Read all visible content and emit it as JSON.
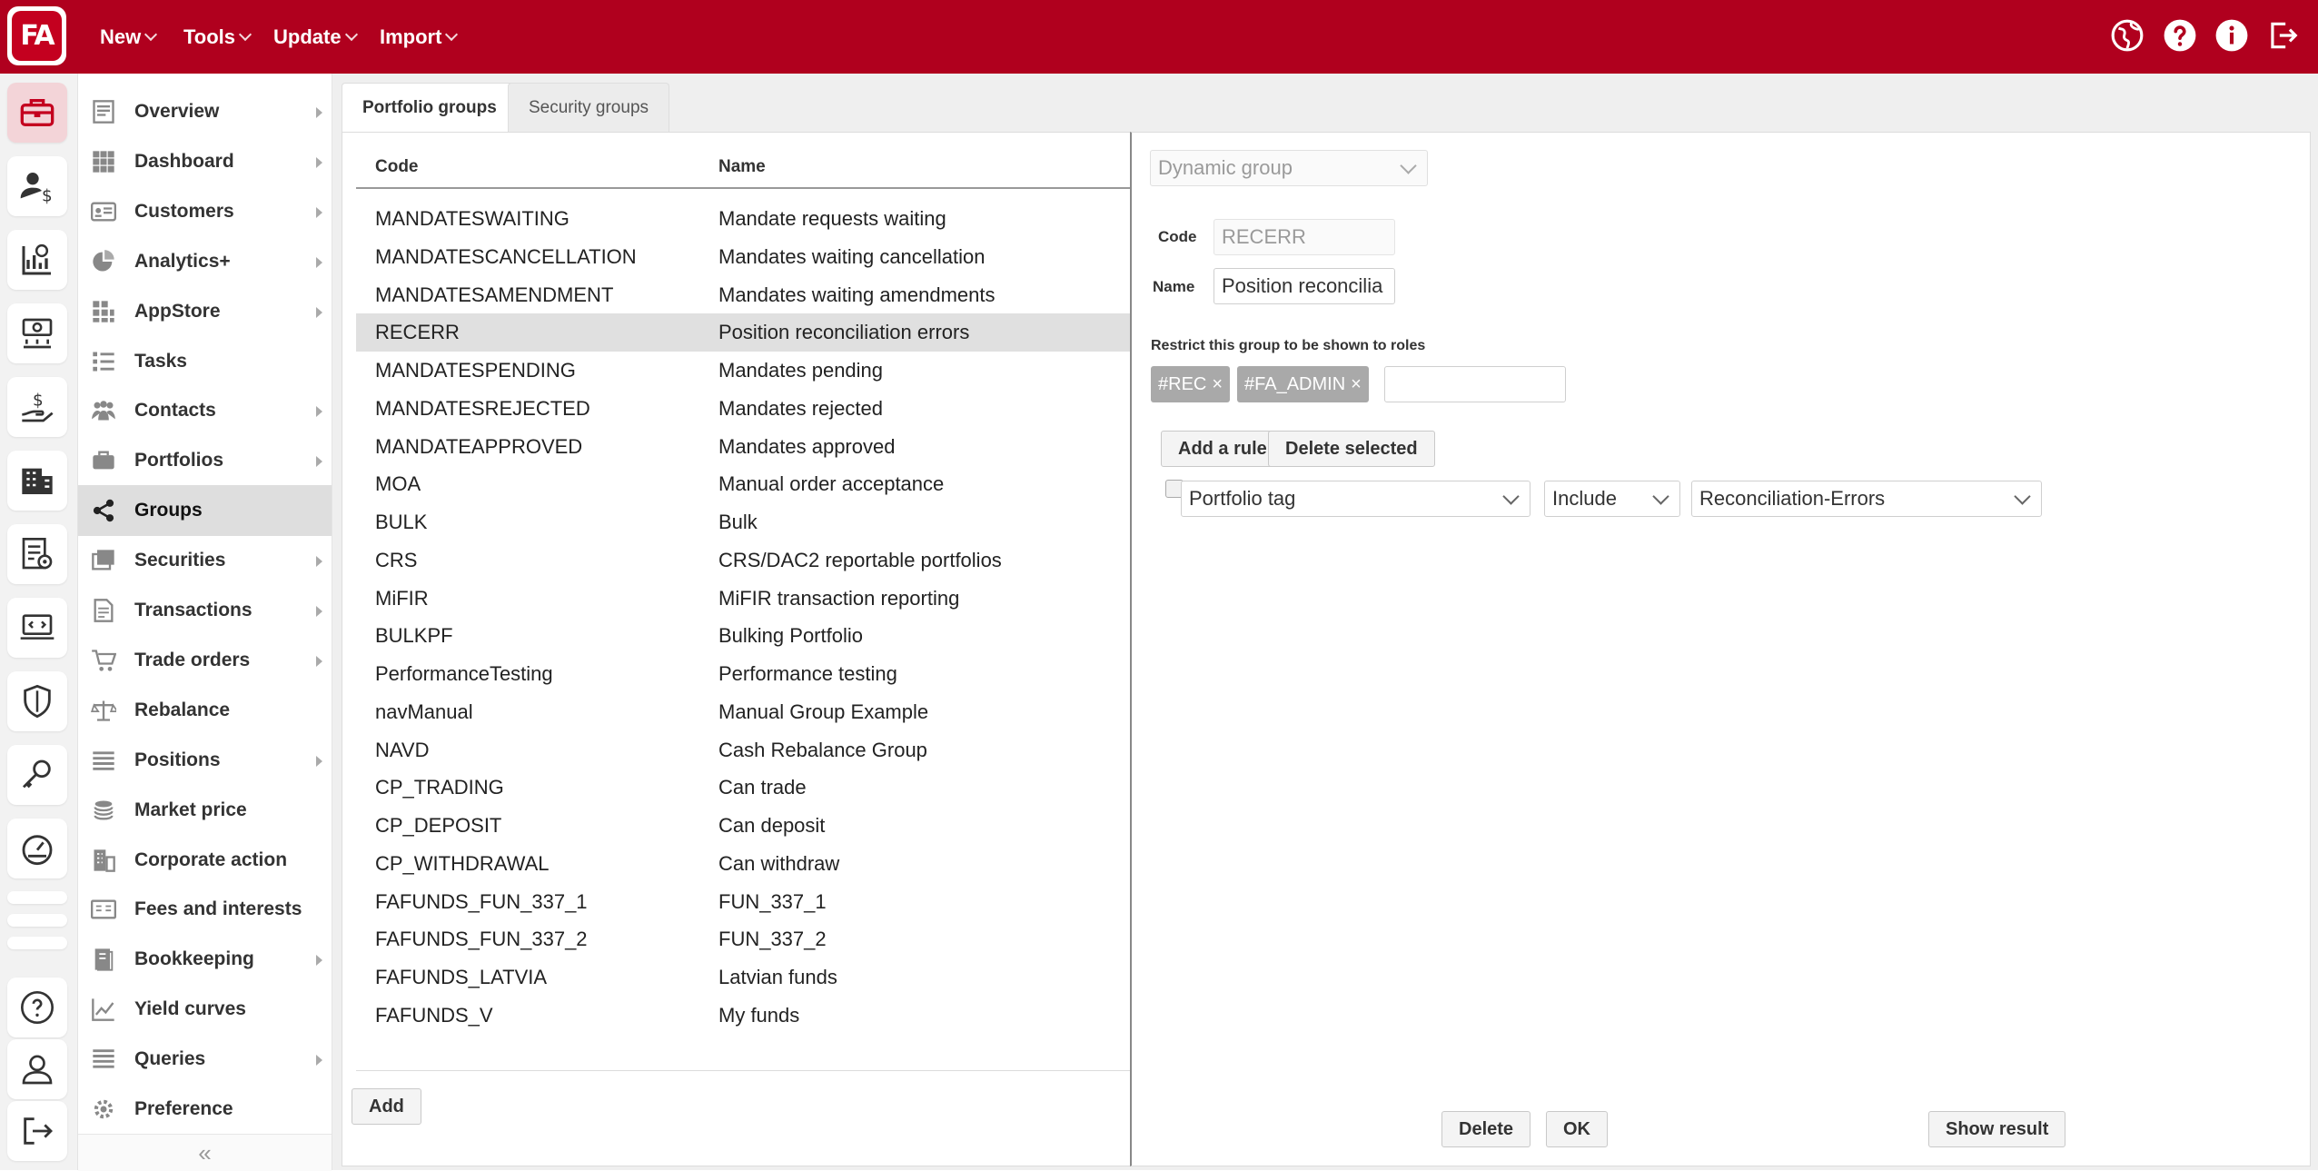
{
  "app": {
    "logo_text": "FA",
    "colors": {
      "brand": "#b0001e",
      "accent_active": "#f3d4d8"
    }
  },
  "topnav": {
    "menus": [
      {
        "label": "New"
      },
      {
        "label": "Tools"
      },
      {
        "label": "Update"
      },
      {
        "label": "Import"
      }
    ],
    "icons": [
      "globe-icon",
      "help-icon",
      "info-icon",
      "logout-icon"
    ]
  },
  "rail": {
    "icons": [
      "briefcase-icon",
      "customer-money-icon",
      "analytics-icon",
      "cash-flow-icon",
      "payment-hand-icon",
      "building-icon",
      "document-settings-icon",
      "laptop-code-icon",
      "shield-icon",
      "key-icon",
      "speedometer-icon",
      "help-circle-icon",
      "user-icon",
      "sign-out-icon"
    ]
  },
  "sidebar": {
    "items": [
      {
        "label": "Overview",
        "icon": "overview-icon",
        "has_arrow": true
      },
      {
        "label": "Dashboard",
        "icon": "dashboard-grid-icon",
        "has_arrow": true
      },
      {
        "label": "Customers",
        "icon": "id-card-icon",
        "has_arrow": true
      },
      {
        "label": "Analytics+",
        "icon": "pie-chart-icon",
        "has_arrow": true
      },
      {
        "label": "AppStore",
        "icon": "apps-icon",
        "has_arrow": true
      },
      {
        "label": "Tasks",
        "icon": "tasks-list-icon",
        "has_arrow": false
      },
      {
        "label": "Contacts",
        "icon": "contacts-icon",
        "has_arrow": true
      },
      {
        "label": "Portfolios",
        "icon": "briefcase-icon",
        "has_arrow": true
      },
      {
        "label": "Groups",
        "icon": "share-icon",
        "has_arrow": false,
        "active": true
      },
      {
        "label": "Securities",
        "icon": "securities-icon",
        "has_arrow": true
      },
      {
        "label": "Transactions",
        "icon": "document-icon",
        "has_arrow": true
      },
      {
        "label": "Trade orders",
        "icon": "cart-icon",
        "has_arrow": true
      },
      {
        "label": "Rebalance",
        "icon": "scale-icon",
        "has_arrow": false
      },
      {
        "label": "Positions",
        "icon": "lines-icon",
        "has_arrow": true
      },
      {
        "label": "Market price",
        "icon": "coins-icon",
        "has_arrow": false
      },
      {
        "label": "Corporate action",
        "icon": "office-icon",
        "has_arrow": false
      },
      {
        "label": "Fees and interests",
        "icon": "fee-icon",
        "has_arrow": false
      },
      {
        "label": "Bookkeeping",
        "icon": "book-icon",
        "has_arrow": true
      },
      {
        "label": "Yield curves",
        "icon": "line-chart-icon",
        "has_arrow": false
      },
      {
        "label": "Queries",
        "icon": "list-icon",
        "has_arrow": true
      },
      {
        "label": "Preference",
        "icon": "gear-icon",
        "has_arrow": false
      }
    ],
    "collapse_glyph": "«"
  },
  "tabs": [
    {
      "label": "Portfolio groups",
      "active": true
    },
    {
      "label": "Security groups",
      "active": false
    }
  ],
  "table": {
    "columns": [
      "Code",
      "Name"
    ],
    "rows": [
      {
        "code": "MANDATESWAITING",
        "name": "Mandate requests waiting"
      },
      {
        "code": "MANDATESCANCELLATION",
        "name": "Mandates waiting cancellation"
      },
      {
        "code": "MANDATESAMENDMENT",
        "name": "Mandates waiting amendments"
      },
      {
        "code": "RECERR",
        "name": "Position reconciliation errors",
        "selected": true
      },
      {
        "code": "MANDATESPENDING",
        "name": "Mandates pending"
      },
      {
        "code": "MANDATESREJECTED",
        "name": "Mandates rejected"
      },
      {
        "code": "MANDATEAPPROVED",
        "name": "Mandates approved"
      },
      {
        "code": "MOA",
        "name": "Manual order acceptance"
      },
      {
        "code": "BULK",
        "name": "Bulk"
      },
      {
        "code": "CRS",
        "name": "CRS/DAC2 reportable portfolios"
      },
      {
        "code": "MiFIR",
        "name": "MiFIR transaction reporting"
      },
      {
        "code": "BULKPF",
        "name": "Bulking Portfolio"
      },
      {
        "code": "PerformanceTesting",
        "name": "Performance testing"
      },
      {
        "code": "navManual",
        "name": "Manual Group Example"
      },
      {
        "code": "NAVD",
        "name": "Cash Rebalance Group"
      },
      {
        "code": "CP_TRADING",
        "name": "Can trade"
      },
      {
        "code": "CP_DEPOSIT",
        "name": "Can deposit"
      },
      {
        "code": "CP_WITHDRAWAL",
        "name": "Can withdraw"
      },
      {
        "code": "FAFUNDS_FUN_337_1",
        "name": "FUN_337_1"
      },
      {
        "code": "FAFUNDS_FUN_337_2",
        "name": "FUN_337_2"
      },
      {
        "code": "FAFUNDS_LATVIA",
        "name": "Latvian funds"
      },
      {
        "code": "FAFUNDS_V",
        "name": "My funds"
      }
    ],
    "add_label": "Add"
  },
  "detail": {
    "group_type": "Dynamic group",
    "code_label": "Code",
    "code_value": "RECERR",
    "name_label": "Name",
    "name_value": "Position reconcilia",
    "roles_label": "Restrict this group to be shown to roles",
    "roles": [
      "#REC",
      "#FA_ADMIN"
    ],
    "role_remove_glyph": "×",
    "add_rule_label": "Add a rule",
    "delete_selected_label": "Delete selected",
    "rule": {
      "field": "Portfolio tag",
      "operator": "Include",
      "value": "Reconciliation-Errors"
    },
    "delete_label": "Delete",
    "ok_label": "OK",
    "show_result_label": "Show result"
  }
}
